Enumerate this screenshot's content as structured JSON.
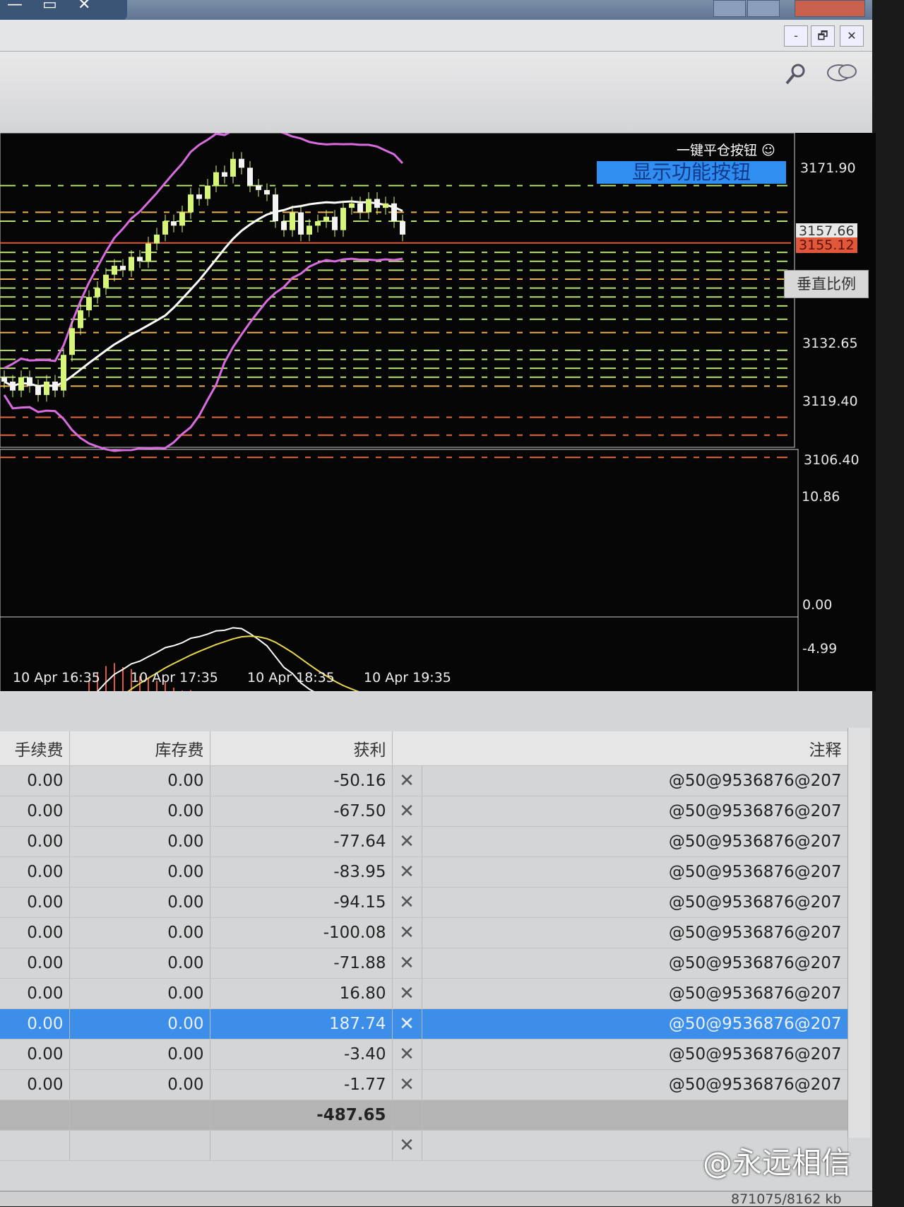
{
  "window": {
    "min": "—",
    "restore": "▭",
    "close": "✕"
  },
  "inner_window": {
    "min": "-",
    "restore": "🗗",
    "close": "✕"
  },
  "toolbar": {
    "search_icon": "magnifier-icon",
    "chat_icon": "chat-icon"
  },
  "chart": {
    "one_key_close_label": "一键平仓按钮 ☺",
    "show_function_button": "显示功能按钮",
    "vertical_scale_button": "垂直比例",
    "price_labels": [
      "3171.90",
      "3132.65",
      "3119.40",
      "3106.40"
    ],
    "bid_tag": "3157.66",
    "ask_tag": "3155.12",
    "macd_labels": [
      "10.86",
      "0.00",
      "-4.99"
    ],
    "time_labels": [
      "10 Apr 16:35",
      "10 Apr 17:35",
      "10 Apr 18:35",
      "10 Apr 19:35"
    ],
    "colors": {
      "bull": "#d6f57a",
      "band": "#d86be0",
      "mid": "#ffffff",
      "signal": "#e8d64a",
      "hist_pos": "#e0573a",
      "hist_neg": "#7fd6e0",
      "ask": "#e0573a"
    }
  },
  "chart_data": {
    "type": "candlestick",
    "ylim": [
      3106.4,
      3171.9
    ],
    "closes": [
      3124,
      3122,
      3125,
      3123,
      3121,
      3124,
      3122,
      3130,
      3136,
      3140,
      3143,
      3145,
      3148,
      3150,
      3149,
      3152,
      3151,
      3155,
      3157,
      3160,
      3159,
      3162,
      3166,
      3165,
      3168,
      3171,
      3170,
      3174,
      3172,
      3168,
      3167,
      3166,
      3160,
      3158,
      3162,
      3157,
      3159,
      3160,
      3161,
      3158,
      3163,
      3164,
      3162,
      3165,
      3163,
      3164,
      3160,
      3157
    ],
    "levels": [
      3168,
      3162,
      3160,
      3153,
      3151,
      3149,
      3147,
      3145,
      3143,
      3141,
      3138,
      3135,
      3131,
      3129,
      3127,
      3125,
      3123,
      3116,
      3112,
      3107
    ]
  },
  "table": {
    "headers": [
      "手续费",
      "库存费",
      "获利",
      "",
      "注释"
    ],
    "rows": [
      [
        "0.00",
        "0.00",
        "-50.16",
        "✕",
        "@50@9536876@207"
      ],
      [
        "0.00",
        "0.00",
        "-67.50",
        "✕",
        "@50@9536876@207"
      ],
      [
        "0.00",
        "0.00",
        "-77.64",
        "✕",
        "@50@9536876@207"
      ],
      [
        "0.00",
        "0.00",
        "-83.95",
        "✕",
        "@50@9536876@207"
      ],
      [
        "0.00",
        "0.00",
        "-94.15",
        "✕",
        "@50@9536876@207"
      ],
      [
        "0.00",
        "0.00",
        "-100.08",
        "✕",
        "@50@9536876@207"
      ],
      [
        "0.00",
        "0.00",
        "-71.88",
        "✕",
        "@50@9536876@207"
      ],
      [
        "0.00",
        "0.00",
        "16.80",
        "✕",
        "@50@9536876@207"
      ],
      [
        "0.00",
        "0.00",
        "187.74",
        "✕",
        "@50@9536876@207"
      ],
      [
        "0.00",
        "0.00",
        "-3.40",
        "✕",
        "@50@9536876@207"
      ],
      [
        "0.00",
        "0.00",
        "-1.77",
        "✕",
        "@50@9536876@207"
      ]
    ],
    "selected_index": 8,
    "total": "-487.65",
    "pending_close": "✕"
  },
  "status": {
    "traffic": "871075/8162 kb"
  },
  "watermark": "@永远相信"
}
